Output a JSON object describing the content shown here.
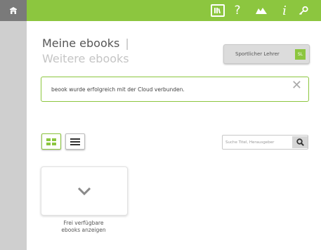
{
  "header": {
    "icons": [
      "library-icon",
      "help-icon",
      "mountain-icon",
      "info-icon",
      "key-icon"
    ],
    "help_glyph": "?",
    "info_glyph": "i",
    "accent": "#8cc63f"
  },
  "main": {
    "title_mine": "Meine ebooks",
    "title_separator": "|",
    "title_more": "Weitere ebooks",
    "user_button_label": "Sportlicher Lehrer",
    "user_button_badge": "SL",
    "alert_message": "beook wurde erfolgreich mit der Cloud verbunden.",
    "alert_close": "✕",
    "search_placeholder": "Suche Titel, Herausgeber",
    "tile_caption_line1": "Frei verfügbare",
    "tile_caption_line2": "ebooks anzeigen"
  }
}
